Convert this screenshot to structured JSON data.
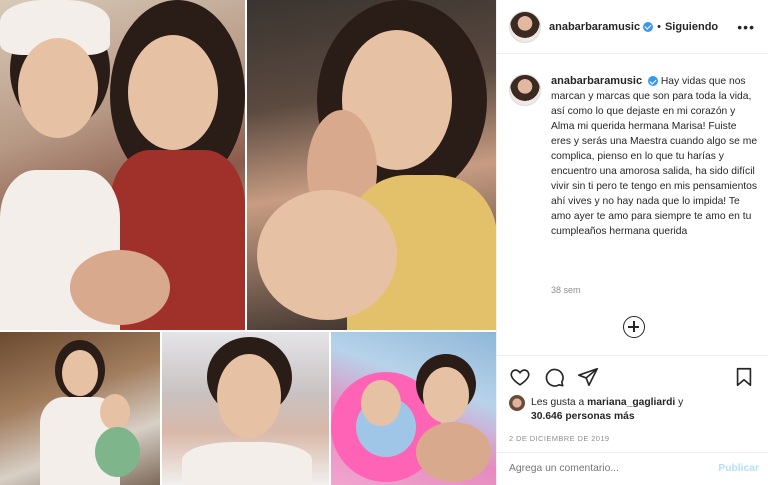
{
  "post": {
    "username": "anabarbaramusic",
    "separator": "•",
    "follow_status": "Siguiendo",
    "more_label": "•••",
    "caption_username": "anabarbaramusic",
    "caption": "Hay vidas que nos marcan y marcas que son para toda la vida, así como lo que dejaste en mi corazón y Alma mi querida hermana Marisa! Fuiste eres y serás una Maestra cuando algo se me complica, pienso en lo que tu harías y encuentro una amorosa salida, ha sido difícil vivir sin ti pero te tengo en mis pensamientos ahí vives y no hay nada que lo impida! Te amo ayer te amo para siempre te amo en tu cumpleaños hermana querida",
    "age": "38 sem"
  },
  "likes": {
    "prefix": "Les gusta a",
    "liker": "mariana_gagliardi",
    "suffix": "y",
    "count": "30.646 personas más"
  },
  "date": "2 DE DICIEMBRE DE 2019",
  "comment": {
    "placeholder": "Agrega un comentario...",
    "publish_label": "Publicar"
  },
  "colors": {
    "verified": "#3897f0",
    "publish_disabled": "#b2dffc",
    "muted_text": "#8e8e8e"
  },
  "icons": [
    "heart-icon",
    "comment-icon",
    "share-icon",
    "bookmark-icon",
    "add-comment-icon",
    "verified-badge-icon"
  ]
}
